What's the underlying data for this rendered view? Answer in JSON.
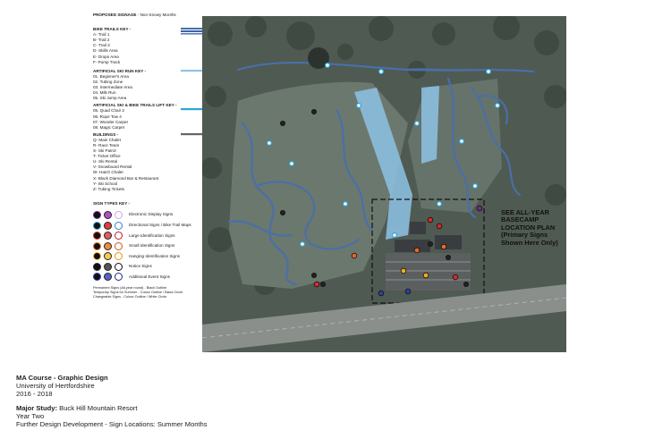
{
  "legend": {
    "title": "PROPOSED SIGNAGE",
    "subtitle": "- Non-Snowy Months",
    "bike_key": {
      "heading": "BIKE TRAILS KEY -",
      "items": [
        "A- Trail 1",
        "B- Trail 2",
        "C- Trail 3",
        "D- Skills Area",
        "E- Drops Area",
        "F- Pump Track"
      ],
      "colors": [
        "#4a6fa8",
        "#3d63a6"
      ]
    },
    "ski_key": {
      "heading": "ARTIFICIAL SKI RUN KEY -",
      "items": [
        "01. Beginner's Area",
        "02. Tubing Zone",
        "03. Intermediate Area",
        "04. Milk Run",
        "05. Ski Jump Area"
      ],
      "color": "#8ec3e6"
    },
    "lift_key": {
      "heading": "ARTIFICIAL SKI & BIKE TRAILS LIFT KEY -",
      "items": [
        "05. Quad Chair 2",
        "06. Rope Tow 4",
        "07. Wonder Carpet",
        "08. Magic Carpet"
      ],
      "color": "#2aa7d8"
    },
    "buildings": {
      "heading": "BUILDINGS -",
      "items": [
        "Q- Main Chalet",
        "R- Race Team",
        "S- Ski Patrol",
        "T- Ticket Office",
        "U- Ski Rental",
        "V- Snowboard Rental",
        "W- Hatch Chalet",
        "X- Black Diamond Bar & Restaurant",
        "Y- Ski School",
        "Z- Tubing Tickets"
      ],
      "color": "#666666"
    },
    "sign_types": {
      "heading": "SIGN TYPES KEY -",
      "rows": [
        {
          "label": "Electronic Display Signs",
          "colors": [
            "#7a2a8c",
            "#b04fc0",
            "#d9a6e2"
          ]
        },
        {
          "label": "Directional Signs / Bike Trail Maps",
          "colors": [
            "#2aa7d8",
            "#e23b3b",
            "#3b7fd8"
          ]
        },
        {
          "label": "Large Identification Signs",
          "colors": [
            "#d92b2b",
            "#e85b5b",
            "#c01f1f"
          ]
        },
        {
          "label": "Small Identification Signs",
          "colors": [
            "#e8692a",
            "#f08a3e",
            "#d9531a"
          ]
        },
        {
          "label": "Hanging Identification Signs",
          "colors": [
            "#f2b01e",
            "#f7c94a",
            "#e09a10"
          ]
        },
        {
          "label": "Notice Signs",
          "colors": [
            "#2b2b2b",
            "#555555",
            "#111111"
          ]
        },
        {
          "label": "Additional Event Signs",
          "colors": [
            "#2f3fa6",
            "#5562c4",
            "#1e2b85"
          ]
        }
      ]
    },
    "notes": [
      "Permanent Signs (All-year round) - Black Outline",
      "Temporary Signs for Summer - Colour Outline / Black Circle",
      "Changeable Signs - Colour Outline / White Circle"
    ]
  },
  "map": {
    "callout": [
      "SEE ALL-YEAR",
      "BASECAMP",
      "LOCATION PLAN",
      "(Primary Signs",
      "Shown Here Only)"
    ]
  },
  "footer": {
    "course": "MA Course - Graphic Design",
    "university": "University of Hertfordshire",
    "years": "2016 - 2018",
    "major_label": "Major Study:",
    "major_value": "Buck Hill Mountain Resort",
    "year_two": "Year Two",
    "development": "Further Design Development - Sign Locations: Summer Months"
  }
}
